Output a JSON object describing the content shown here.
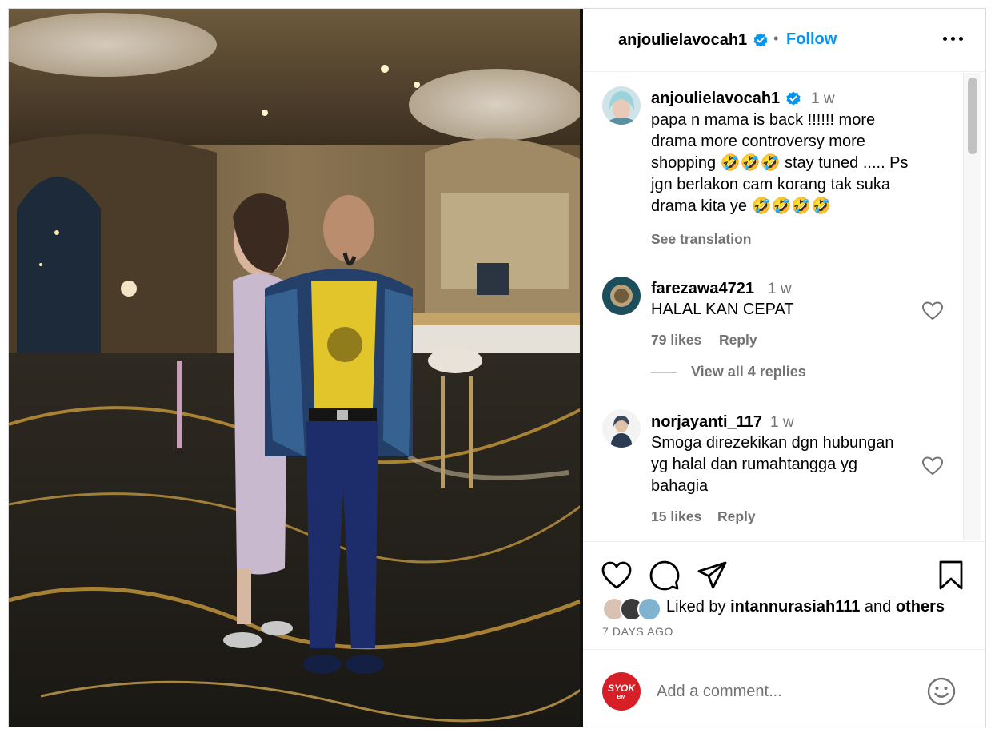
{
  "post": {
    "author": "anjoulielavocah1",
    "follow_label": "Follow",
    "separator": "•"
  },
  "caption": {
    "username": "anjoulielavocah1",
    "time": "1 w",
    "lines": [
      "papa n mama is back !!!!!! more",
      "drama more controversy more",
      "shopping 🤣🤣🤣 stay tuned ..... Ps",
      "jgn berlakon cam korang tak suka",
      "drama kita ye 🤣🤣🤣🤣"
    ],
    "see_translation": "See translation"
  },
  "comments": [
    {
      "username": "farezawa4721",
      "time": "1 w",
      "lines": [
        "HALAL KAN CEPAT"
      ],
      "likes": "79 likes",
      "reply": "Reply",
      "view_replies": "View all 4 replies"
    },
    {
      "username": "norjayanti_117",
      "time": "1 w",
      "lines": [
        "Smoga direzekikan dgn hubungan",
        "yg halal dan rumahtangga yg",
        "bahagia"
      ],
      "likes": "15 likes",
      "reply": "Reply"
    }
  ],
  "likes_summary": {
    "prefix": "Liked by",
    "user": "intannurasiah111",
    "joiner": "and",
    "others": "others"
  },
  "posted_ago": "7 DAYS AGO",
  "composer": {
    "placeholder": "Add a comment...",
    "avatar_text": "SYOK",
    "avatar_subtext": "BM"
  },
  "colors": {
    "link_blue": "#0095f6",
    "muted_gray": "#737373",
    "verified_blue": "#0095f6",
    "composer_avatar_red": "#d61f26"
  },
  "icons": {
    "like": "heart-icon",
    "comment": "comment-bubble-icon",
    "share": "paper-plane-icon",
    "save": "bookmark-icon",
    "more": "ellipsis-icon",
    "emoji": "emoji-smile-icon",
    "verified": "verified-badge-icon"
  }
}
